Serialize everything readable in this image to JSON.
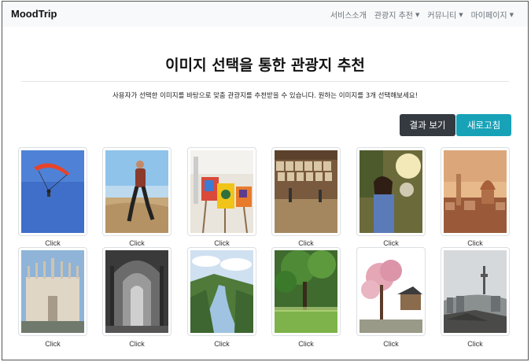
{
  "navbar": {
    "brand": "MoodTrip",
    "items": [
      {
        "label": "서비스소개",
        "has_caret": false
      },
      {
        "label": "관광지 추천",
        "has_caret": true
      },
      {
        "label": "커뮤니티",
        "has_caret": true
      },
      {
        "label": "마이페이지",
        "has_caret": true
      }
    ]
  },
  "main": {
    "title": "이미지 선택을 통한 관광지 추천",
    "description": "사용자가 선택한 이미지를 바탕으로 맞춤 관광지를 추천받을 수 있습니다. 원하는 이미지를 3개 선택해보세요!",
    "buttons": {
      "result": "결과 보기",
      "reset": "새로고침"
    },
    "images": [
      {
        "caption": "Click"
      },
      {
        "caption": "Click"
      },
      {
        "caption": "Click"
      },
      {
        "caption": "Click"
      },
      {
        "caption": "Click"
      },
      {
        "caption": "Click"
      },
      {
        "caption": "Click"
      },
      {
        "caption": "Click"
      },
      {
        "caption": "Click"
      },
      {
        "caption": "Click"
      },
      {
        "caption": "Click"
      },
      {
        "caption": "Click"
      }
    ]
  },
  "colors": {
    "result_button": "#343a40",
    "reset_button": "#17a2b8",
    "navbar_bg": "#f8f9fa"
  }
}
